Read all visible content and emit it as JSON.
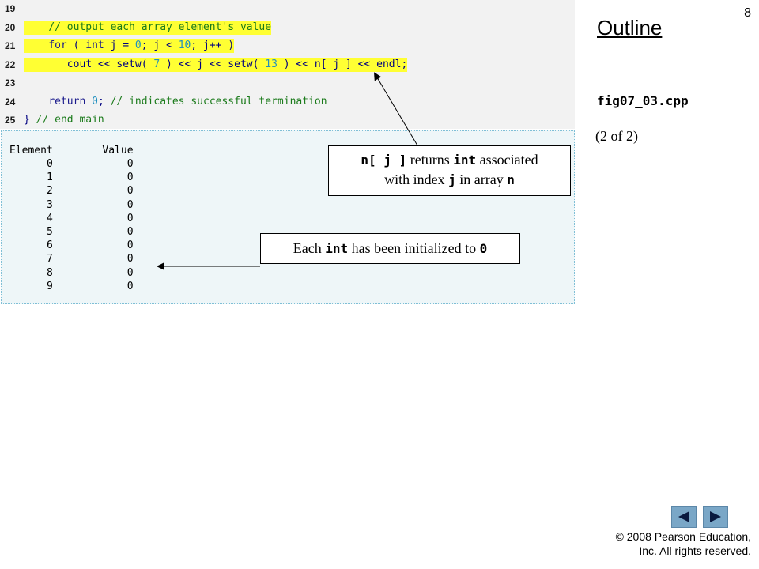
{
  "slide_number": "8",
  "outline": {
    "title": "Outline",
    "file_name": "fig07_03.cpp",
    "page_part": "(2 of 2)"
  },
  "code_lines": [
    {
      "no": "19",
      "segments": []
    },
    {
      "no": "20",
      "highlight": true,
      "segments": [
        {
          "t": "    ",
          "c": "plain"
        },
        {
          "t": "// output each array element's value",
          "c": "cm"
        }
      ]
    },
    {
      "no": "21",
      "highlight": true,
      "segments": [
        {
          "t": "    ",
          "c": "plain"
        },
        {
          "t": "for",
          "c": "kw"
        },
        {
          "t": " ( ",
          "c": "plain"
        },
        {
          "t": "int",
          "c": "kw"
        },
        {
          "t": " j = ",
          "c": "plain"
        },
        {
          "t": "0",
          "c": "num"
        },
        {
          "t": "; j < ",
          "c": "plain"
        },
        {
          "t": "10",
          "c": "num"
        },
        {
          "t": "; j++ )",
          "c": "plain"
        }
      ]
    },
    {
      "no": "22",
      "highlight": true,
      "segments": [
        {
          "t": "       cout << setw( ",
          "c": "plain"
        },
        {
          "t": "7",
          "c": "num"
        },
        {
          "t": " ) << j << setw( ",
          "c": "plain"
        },
        {
          "t": "13",
          "c": "num"
        },
        {
          "t": " ) << n[ j ] << endl;",
          "c": "plain"
        }
      ]
    },
    {
      "no": "23",
      "segments": []
    },
    {
      "no": "24",
      "segments": [
        {
          "t": "    ",
          "c": "plain"
        },
        {
          "t": "return",
          "c": "kw"
        },
        {
          "t": " ",
          "c": "plain"
        },
        {
          "t": "0",
          "c": "num"
        },
        {
          "t": "; ",
          "c": "plain"
        },
        {
          "t": "// indicates successful termination",
          "c": "cm"
        }
      ]
    },
    {
      "no": "25",
      "segments": [
        {
          "t": "} ",
          "c": "plain"
        },
        {
          "t": "// end main",
          "c": "cm"
        }
      ]
    }
  ],
  "output": {
    "header": "Element        Value",
    "rows": [
      "      0            0",
      "      1            0",
      "      2            0",
      "      3            0",
      "      4            0",
      "      5            0",
      "      6            0",
      "      7            0",
      "      8            0",
      "      9            0"
    ]
  },
  "callouts": {
    "index_code": "n[ j ]",
    "index_text_1": " returns ",
    "index_type": "int",
    "index_text_2": " associated",
    "index_text_3": "with index ",
    "index_var": "j",
    "index_text_4": " in array ",
    "index_arr": "n",
    "init_text_1": "Each ",
    "init_type": "int",
    "init_text_2": " has been initialized to ",
    "init_value": "0"
  },
  "copyright": {
    "line1": "© 2008 Pearson Education,",
    "line2": "Inc.  All rights reserved."
  },
  "nav": {
    "prev_icon": "triangle-left-icon",
    "next_icon": "triangle-right-icon"
  }
}
